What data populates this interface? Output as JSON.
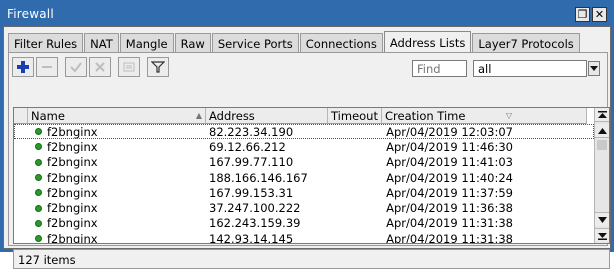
{
  "window": {
    "title": "Firewall",
    "restore_glyph": "❐",
    "close_glyph": "✕"
  },
  "tabs": [
    {
      "label": "Filter Rules"
    },
    {
      "label": "NAT"
    },
    {
      "label": "Mangle"
    },
    {
      "label": "Raw"
    },
    {
      "label": "Service Ports"
    },
    {
      "label": "Connections"
    },
    {
      "label": "Address Lists",
      "active": true
    },
    {
      "label": "Layer7 Protocols"
    }
  ],
  "toolbar": {
    "buttons": [
      "add-icon",
      "remove-icon",
      "enable-icon",
      "disable-icon",
      "comment-icon",
      "filter-icon"
    ]
  },
  "search": {
    "placeholder": "Find"
  },
  "list_filter": {
    "value": "all"
  },
  "table": {
    "columns": [
      "Name",
      "Address",
      "Timeout",
      "Creation Time"
    ],
    "rows": [
      {
        "name": "f2bnginx",
        "address": "82.223.34.190",
        "timeout": "",
        "creation_time": "Apr/04/2019 12:03:07"
      },
      {
        "name": "f2bnginx",
        "address": "69.12.66.212",
        "timeout": "",
        "creation_time": "Apr/04/2019 11:46:30"
      },
      {
        "name": "f2bnginx",
        "address": "167.99.77.110",
        "timeout": "",
        "creation_time": "Apr/04/2019 11:41:03"
      },
      {
        "name": "f2bnginx",
        "address": "188.166.146.167",
        "timeout": "",
        "creation_time": "Apr/04/2019 11:40:24"
      },
      {
        "name": "f2bnginx",
        "address": "167.99.153.31",
        "timeout": "",
        "creation_time": "Apr/04/2019 11:37:59"
      },
      {
        "name": "f2bnginx",
        "address": "37.247.100.222",
        "timeout": "",
        "creation_time": "Apr/04/2019 11:36:38"
      },
      {
        "name": "f2bnginx",
        "address": "162.243.159.39",
        "timeout": "",
        "creation_time": "Apr/04/2019 11:31:38"
      },
      {
        "name": "f2bnginx",
        "address": "142.93.14.145",
        "timeout": "",
        "creation_time": "Apr/04/2019 11:31:38"
      }
    ]
  },
  "status": {
    "items_count": "127 items"
  },
  "colors": {
    "titlebar": "#2f6bad",
    "status_dot": "#2a9a2a",
    "add_icon": "#1a3fb0"
  }
}
